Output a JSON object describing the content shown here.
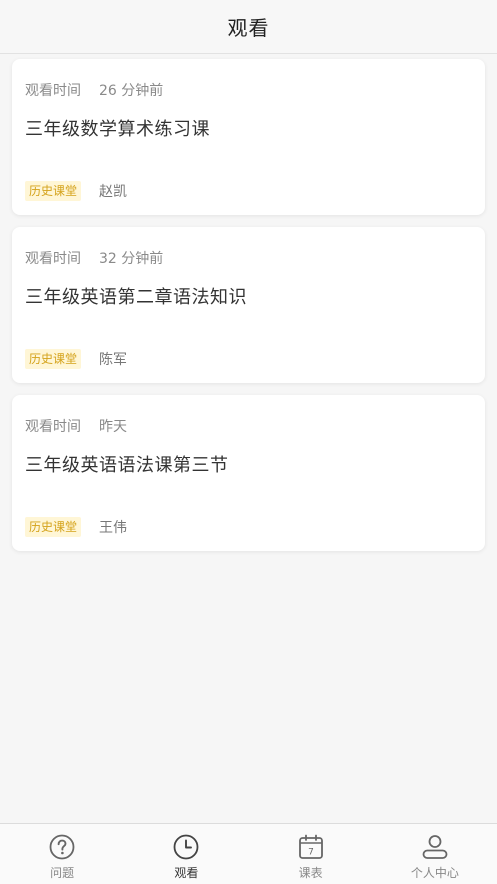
{
  "header": {
    "title": "观看"
  },
  "cards": [
    {
      "meta_label": "观看时间",
      "time": "26 分钟前",
      "title": "三年级数学算术练习课",
      "tag": "历史课堂",
      "teacher": "赵凯"
    },
    {
      "meta_label": "观看时间",
      "time": "32 分钟前",
      "title": "三年级英语第二章语法知识",
      "tag": "历史课堂",
      "teacher": "陈军"
    },
    {
      "meta_label": "观看时间",
      "time": "昨天",
      "title": "三年级英语语法课第三节",
      "tag": "历史课堂",
      "teacher": "王伟"
    }
  ],
  "tabbar": {
    "items": [
      {
        "label": "问题",
        "icon": "question-circle-icon",
        "active": false
      },
      {
        "label": "观看",
        "icon": "clock-icon",
        "active": true
      },
      {
        "label": "课表",
        "icon": "calendar-icon",
        "active": false,
        "calendar_day": "7"
      },
      {
        "label": "个人中心",
        "icon": "user-icon",
        "active": false
      }
    ]
  },
  "colors": {
    "tag_background": "#fff6d6",
    "tag_text": "#d4a21a",
    "background": "#f6f6f6",
    "card": "#ffffff"
  }
}
